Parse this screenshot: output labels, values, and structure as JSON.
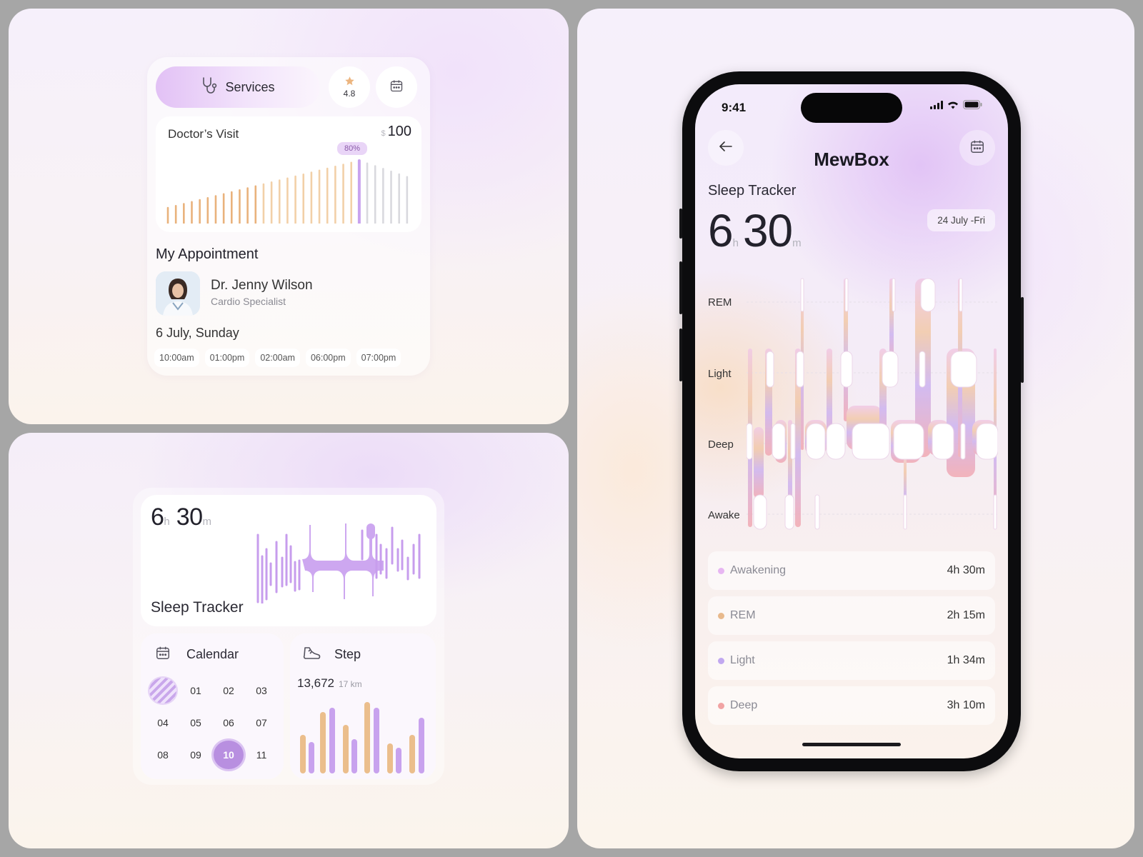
{
  "top_widget": {
    "services_label": "Services",
    "rating": "4.8",
    "doctor_visit": {
      "title": "Doctor’s Visit",
      "currency": "$",
      "price": "100",
      "progress_label": "80%",
      "progress_fraction": 0.8
    },
    "appointment_title": "My Appointment",
    "doctor_name": "Dr. Jenny Wilson",
    "doctor_specialty": "Cardio Specialist",
    "date": "6 July, Sunday",
    "time_slots": [
      "10:00am",
      "01:00pm",
      "02:00am",
      "06:00pm",
      "07:00pm"
    ]
  },
  "sleep_widget": {
    "hours": "6",
    "hours_unit": "h",
    "minutes": "30",
    "minutes_unit": "m",
    "title": "Sleep Tracker"
  },
  "calendar_widget": {
    "title": "Calendar",
    "days": [
      "",
      "01",
      "02",
      "03",
      "04",
      "05",
      "06",
      "07",
      "08",
      "09",
      "10",
      "11"
    ],
    "selected_day": "10"
  },
  "step_widget": {
    "title": "Step",
    "steps": "13,672",
    "distance": "17 km"
  },
  "phone": {
    "status_time": "9:41",
    "app_title": "MewBox",
    "section_title": "Sleep Tracker",
    "hours": "6",
    "hours_unit": "h",
    "minutes": "30",
    "minutes_unit": "m",
    "date_chip": "24 July -Fri",
    "stages": [
      "REM",
      "Light",
      "Deep",
      "Awake"
    ],
    "summary": [
      {
        "name": "Awakening",
        "value": "4h 30m",
        "color": "#e7b6f2"
      },
      {
        "name": "REM",
        "value": "2h 15m",
        "color": "#e8b98c"
      },
      {
        "name": "Light",
        "value": "1h 34m",
        "color": "#c1a8f0"
      },
      {
        "name": "Deep",
        "value": "3h 10m",
        "color": "#f1a3a3"
      }
    ]
  },
  "colors": {
    "accent_purple": "#c8a2ee",
    "accent_orange": "#ebbe8c",
    "bar_grey": "#d9d9de"
  }
}
